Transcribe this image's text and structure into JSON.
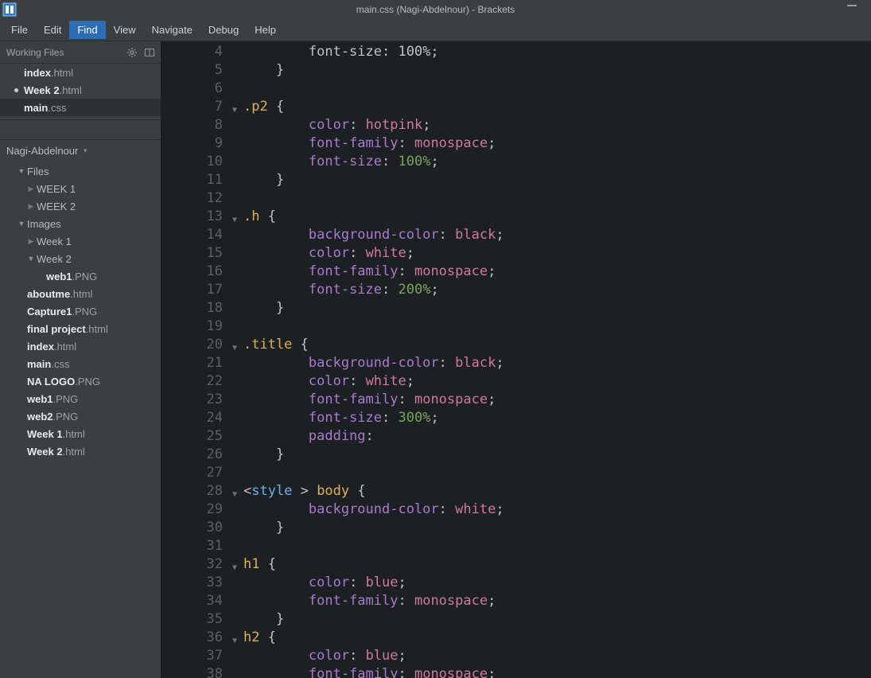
{
  "titlebar": {
    "title": "main.css (Nagi-Abdelnour) - Brackets"
  },
  "menu": {
    "file": "File",
    "edit": "Edit",
    "find": "Find",
    "view": "View",
    "navigate": "Navigate",
    "debug": "Debug",
    "help": "Help"
  },
  "workingFiles": {
    "label": "Working Files",
    "items": [
      {
        "name": "index",
        "ext": ".html",
        "dot": false,
        "active": false
      },
      {
        "name": "Week 2",
        "ext": ".html",
        "dot": true,
        "active": false
      },
      {
        "name": "main",
        "ext": ".css",
        "dot": false,
        "active": true
      }
    ]
  },
  "project": {
    "name": "Nagi-Abdelnour"
  },
  "tree": {
    "filesLabel": "Files",
    "items": [
      {
        "depth": 1,
        "arrow": "down",
        "label": "Files",
        "bold": false,
        "type": "folder",
        "dim": false
      },
      {
        "depth": 2,
        "arrow": "right",
        "label": "WEEK 1",
        "bold": false,
        "type": "folder",
        "dim": true
      },
      {
        "depth": 2,
        "arrow": "right",
        "label": "WEEK 2",
        "bold": false,
        "type": "folder",
        "dim": true
      },
      {
        "depth": 1,
        "arrow": "down",
        "label": "Images",
        "bold": false,
        "type": "folder",
        "dim": false
      },
      {
        "depth": 2,
        "arrow": "right",
        "label": "Week 1",
        "bold": false,
        "type": "folder",
        "dim": true
      },
      {
        "depth": 2,
        "arrow": "down",
        "label": "Week 2",
        "bold": false,
        "type": "folder",
        "dim": false
      },
      {
        "depth": 3,
        "arrow": "",
        "name": "web1",
        "ext": ".PNG",
        "type": "file"
      },
      {
        "depth": 1,
        "arrow": "",
        "name": "aboutme",
        "ext": ".html",
        "type": "file"
      },
      {
        "depth": 1,
        "arrow": "",
        "name": "Capture1",
        "ext": ".PNG",
        "type": "file"
      },
      {
        "depth": 1,
        "arrow": "",
        "name": "final project",
        "ext": ".html",
        "type": "file"
      },
      {
        "depth": 1,
        "arrow": "",
        "name": "index",
        "ext": ".html",
        "type": "file"
      },
      {
        "depth": 1,
        "arrow": "",
        "name": "main",
        "ext": ".css",
        "type": "file"
      },
      {
        "depth": 1,
        "arrow": "",
        "name": "NA LOGO",
        "ext": ".PNG",
        "type": "file"
      },
      {
        "depth": 1,
        "arrow": "",
        "name": "web1",
        "ext": ".PNG",
        "type": "file"
      },
      {
        "depth": 1,
        "arrow": "",
        "name": "web2",
        "ext": ".PNG",
        "type": "file"
      },
      {
        "depth": 1,
        "arrow": "",
        "name": "Week 1",
        "ext": ".html",
        "type": "file"
      },
      {
        "depth": 1,
        "arrow": "",
        "name": "Week 2",
        "ext": ".html",
        "type": "file"
      }
    ]
  },
  "code": {
    "lines": [
      {
        "n": 4,
        "fold": "",
        "tokens": [
          {
            "c": "punc",
            "t": "        font-size: 100%;"
          }
        ]
      },
      {
        "n": 5,
        "fold": "",
        "tokens": [
          {
            "c": "brace",
            "t": "    }"
          }
        ]
      },
      {
        "n": 6,
        "fold": "",
        "tokens": [
          {
            "c": "",
            "t": ""
          }
        ]
      },
      {
        "n": 7,
        "fold": "down",
        "tokens": [
          {
            "c": "sel",
            "t": ".p2"
          },
          {
            "c": "",
            "t": " "
          },
          {
            "c": "brace",
            "t": "{"
          }
        ]
      },
      {
        "n": 8,
        "fold": "",
        "tokens": [
          {
            "c": "",
            "t": "        "
          },
          {
            "c": "prop",
            "t": "color"
          },
          {
            "c": "punc",
            "t": ": "
          },
          {
            "c": "val",
            "t": "hotpink"
          },
          {
            "c": "punc",
            "t": ";"
          }
        ]
      },
      {
        "n": 9,
        "fold": "",
        "tokens": [
          {
            "c": "",
            "t": "        "
          },
          {
            "c": "prop",
            "t": "font-family"
          },
          {
            "c": "punc",
            "t": ": "
          },
          {
            "c": "val",
            "t": "monospace"
          },
          {
            "c": "punc",
            "t": ";"
          }
        ]
      },
      {
        "n": 10,
        "fold": "",
        "tokens": [
          {
            "c": "",
            "t": "        "
          },
          {
            "c": "prop",
            "t": "font-size"
          },
          {
            "c": "punc",
            "t": ": "
          },
          {
            "c": "num",
            "t": "100%"
          },
          {
            "c": "punc",
            "t": ";"
          }
        ]
      },
      {
        "n": 11,
        "fold": "",
        "tokens": [
          {
            "c": "brace",
            "t": "    }"
          }
        ]
      },
      {
        "n": 12,
        "fold": "",
        "tokens": [
          {
            "c": "",
            "t": ""
          }
        ]
      },
      {
        "n": 13,
        "fold": "down",
        "tokens": [
          {
            "c": "sel",
            "t": ".h"
          },
          {
            "c": "",
            "t": " "
          },
          {
            "c": "brace",
            "t": "{"
          }
        ]
      },
      {
        "n": 14,
        "fold": "",
        "tokens": [
          {
            "c": "",
            "t": "        "
          },
          {
            "c": "prop",
            "t": "background-color"
          },
          {
            "c": "punc",
            "t": ": "
          },
          {
            "c": "val",
            "t": "black"
          },
          {
            "c": "punc",
            "t": ";"
          }
        ]
      },
      {
        "n": 15,
        "fold": "",
        "tokens": [
          {
            "c": "",
            "t": "        "
          },
          {
            "c": "prop",
            "t": "color"
          },
          {
            "c": "punc",
            "t": ": "
          },
          {
            "c": "val",
            "t": "white"
          },
          {
            "c": "punc",
            "t": ";"
          }
        ]
      },
      {
        "n": 16,
        "fold": "",
        "tokens": [
          {
            "c": "",
            "t": "        "
          },
          {
            "c": "prop",
            "t": "font-family"
          },
          {
            "c": "punc",
            "t": ": "
          },
          {
            "c": "val",
            "t": "monospace"
          },
          {
            "c": "punc",
            "t": ";"
          }
        ]
      },
      {
        "n": 17,
        "fold": "",
        "tokens": [
          {
            "c": "",
            "t": "        "
          },
          {
            "c": "prop",
            "t": "font-size"
          },
          {
            "c": "punc",
            "t": ": "
          },
          {
            "c": "num",
            "t": "200%"
          },
          {
            "c": "punc",
            "t": ";"
          }
        ]
      },
      {
        "n": 18,
        "fold": "",
        "tokens": [
          {
            "c": "brace",
            "t": "    }"
          }
        ]
      },
      {
        "n": 19,
        "fold": "",
        "tokens": [
          {
            "c": "",
            "t": ""
          }
        ]
      },
      {
        "n": 20,
        "fold": "down",
        "tokens": [
          {
            "c": "sel",
            "t": ".title"
          },
          {
            "c": "",
            "t": " "
          },
          {
            "c": "brace",
            "t": "{"
          }
        ]
      },
      {
        "n": 21,
        "fold": "",
        "tokens": [
          {
            "c": "",
            "t": "        "
          },
          {
            "c": "prop",
            "t": "background-color"
          },
          {
            "c": "punc",
            "t": ": "
          },
          {
            "c": "val",
            "t": "black"
          },
          {
            "c": "punc",
            "t": ";"
          }
        ]
      },
      {
        "n": 22,
        "fold": "",
        "tokens": [
          {
            "c": "",
            "t": "        "
          },
          {
            "c": "prop",
            "t": "color"
          },
          {
            "c": "punc",
            "t": ": "
          },
          {
            "c": "val",
            "t": "white"
          },
          {
            "c": "punc",
            "t": ";"
          }
        ]
      },
      {
        "n": 23,
        "fold": "",
        "tokens": [
          {
            "c": "",
            "t": "        "
          },
          {
            "c": "prop",
            "t": "font-family"
          },
          {
            "c": "punc",
            "t": ": "
          },
          {
            "c": "val",
            "t": "monospace"
          },
          {
            "c": "punc",
            "t": ";"
          }
        ]
      },
      {
        "n": 24,
        "fold": "",
        "tokens": [
          {
            "c": "",
            "t": "        "
          },
          {
            "c": "prop",
            "t": "font-size"
          },
          {
            "c": "punc",
            "t": ": "
          },
          {
            "c": "num",
            "t": "300%"
          },
          {
            "c": "punc",
            "t": ";"
          }
        ]
      },
      {
        "n": 25,
        "fold": "",
        "tokens": [
          {
            "c": "",
            "t": "        "
          },
          {
            "c": "prop",
            "t": "padding"
          },
          {
            "c": "punc",
            "t": ":"
          }
        ]
      },
      {
        "n": 26,
        "fold": "",
        "tokens": [
          {
            "c": "brace",
            "t": "    }"
          }
        ]
      },
      {
        "n": 27,
        "fold": "",
        "tokens": [
          {
            "c": "",
            "t": ""
          }
        ]
      },
      {
        "n": 28,
        "fold": "down",
        "tokens": [
          {
            "c": "punc",
            "t": "<"
          },
          {
            "c": "tag",
            "t": "style"
          },
          {
            "c": "",
            "t": " "
          },
          {
            "c": "punc",
            "t": ">"
          },
          {
            "c": "",
            "t": " "
          },
          {
            "c": "sel",
            "t": "body"
          },
          {
            "c": "",
            "t": " "
          },
          {
            "c": "brace",
            "t": "{"
          }
        ]
      },
      {
        "n": 29,
        "fold": "",
        "tokens": [
          {
            "c": "",
            "t": "        "
          },
          {
            "c": "prop",
            "t": "background-color"
          },
          {
            "c": "punc",
            "t": ": "
          },
          {
            "c": "val",
            "t": "white"
          },
          {
            "c": "punc",
            "t": ";"
          }
        ]
      },
      {
        "n": 30,
        "fold": "",
        "tokens": [
          {
            "c": "brace",
            "t": "    }"
          }
        ]
      },
      {
        "n": 31,
        "fold": "",
        "tokens": [
          {
            "c": "",
            "t": ""
          }
        ]
      },
      {
        "n": 32,
        "fold": "down",
        "tokens": [
          {
            "c": "sel",
            "t": "h1"
          },
          {
            "c": "",
            "t": " "
          },
          {
            "c": "brace",
            "t": "{"
          }
        ]
      },
      {
        "n": 33,
        "fold": "",
        "tokens": [
          {
            "c": "",
            "t": "        "
          },
          {
            "c": "prop",
            "t": "color"
          },
          {
            "c": "punc",
            "t": ": "
          },
          {
            "c": "val",
            "t": "blue"
          },
          {
            "c": "punc",
            "t": ";"
          }
        ]
      },
      {
        "n": 34,
        "fold": "",
        "tokens": [
          {
            "c": "",
            "t": "        "
          },
          {
            "c": "prop",
            "t": "font-family"
          },
          {
            "c": "punc",
            "t": ": "
          },
          {
            "c": "val",
            "t": "monospace"
          },
          {
            "c": "punc",
            "t": ";"
          }
        ]
      },
      {
        "n": 35,
        "fold": "",
        "tokens": [
          {
            "c": "brace",
            "t": "    }"
          }
        ]
      },
      {
        "n": 36,
        "fold": "down",
        "tokens": [
          {
            "c": "sel",
            "t": "h2"
          },
          {
            "c": "",
            "t": " "
          },
          {
            "c": "brace",
            "t": "{"
          }
        ]
      },
      {
        "n": 37,
        "fold": "",
        "tokens": [
          {
            "c": "",
            "t": "        "
          },
          {
            "c": "prop",
            "t": "color"
          },
          {
            "c": "punc",
            "t": ": "
          },
          {
            "c": "val",
            "t": "blue"
          },
          {
            "c": "punc",
            "t": ";"
          }
        ]
      },
      {
        "n": 38,
        "fold": "",
        "tokens": [
          {
            "c": "",
            "t": "        "
          },
          {
            "c": "prop",
            "t": "font-family"
          },
          {
            "c": "punc",
            "t": ": "
          },
          {
            "c": "val",
            "t": "monospace"
          },
          {
            "c": "punc",
            "t": ";"
          }
        ]
      }
    ]
  }
}
